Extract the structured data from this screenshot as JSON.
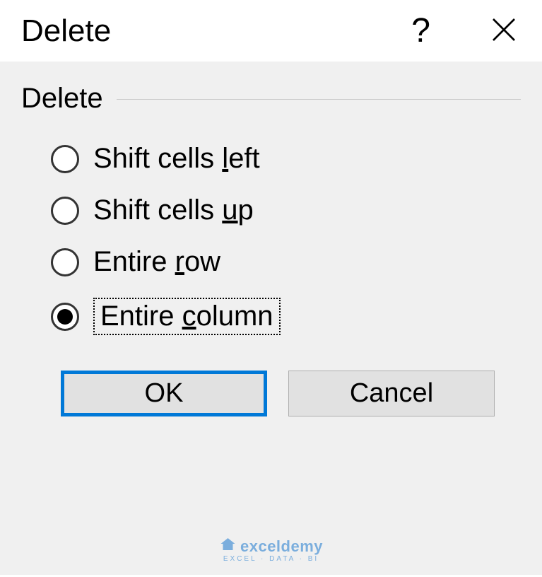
{
  "titlebar": {
    "title": "Delete",
    "help_label": "?",
    "close_label": "Close"
  },
  "fieldset": {
    "legend": "Delete"
  },
  "options": [
    {
      "label_pre": "Shift cells ",
      "label_u": "l",
      "label_post": "eft",
      "checked": false,
      "focused": false
    },
    {
      "label_pre": "Shift cells ",
      "label_u": "u",
      "label_post": "p",
      "checked": false,
      "focused": false
    },
    {
      "label_pre": "Entire ",
      "label_u": "r",
      "label_post": "ow",
      "checked": false,
      "focused": false
    },
    {
      "label_pre": "Entire ",
      "label_u": "c",
      "label_post": "olumn",
      "checked": true,
      "focused": true
    }
  ],
  "buttons": {
    "ok": "OK",
    "cancel": "Cancel"
  },
  "watermark": {
    "name": "exceldemy",
    "sub": "EXCEL · DATA · BI"
  }
}
